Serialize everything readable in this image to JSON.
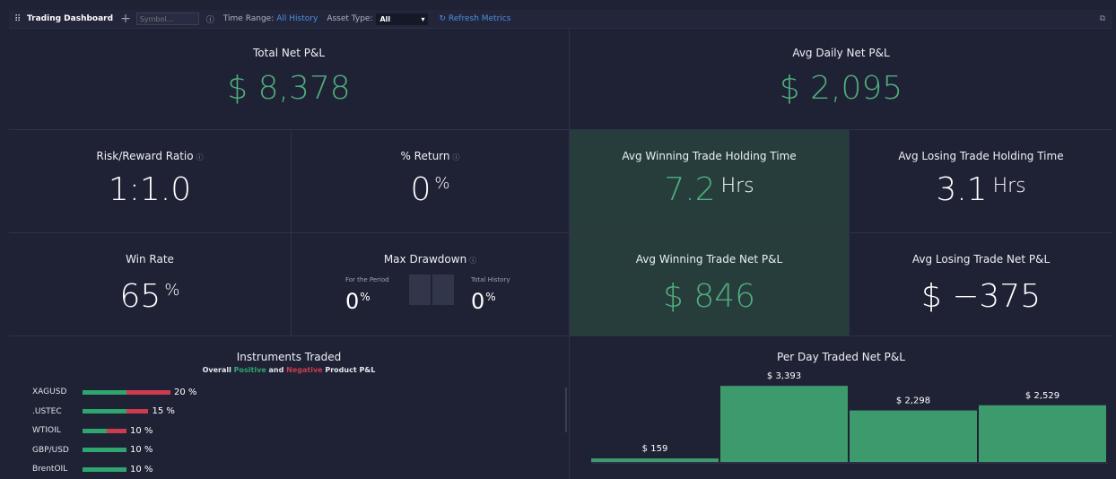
{
  "toolbar": {
    "title": "Trading Dashboard",
    "symbol_placeholder": "Symbol...",
    "time_range_label": "Time Range:",
    "time_range_value": "All History",
    "asset_type_label": "Asset Type:",
    "asset_type_value": "All",
    "refresh_label": "Refresh Metrics"
  },
  "total_pnl": {
    "label": "Total Net P&L",
    "value": "$ 8,378"
  },
  "avg_daily_pnl": {
    "label": "Avg Daily Net P&L",
    "value": "$ 2,095"
  },
  "risk_reward": {
    "label": "Risk/Reward Ratio",
    "value": "1:1.0"
  },
  "pct_return": {
    "label": "% Return",
    "value": "0",
    "unit": "%"
  },
  "avg_win_time": {
    "label": "Avg Winning Trade Holding Time",
    "value": "7.2",
    "unit": "Hrs"
  },
  "avg_loss_time": {
    "label": "Avg Losing Trade Holding Time",
    "value": "3.1",
    "unit": "Hrs"
  },
  "win_rate": {
    "label": "Win Rate",
    "value": "65",
    "unit": "%"
  },
  "max_drawdown": {
    "label": "Max Drawdown",
    "period_label": "For the Period",
    "period_value": "0",
    "history_label": "Total History",
    "history_value": "0",
    "unit": "%"
  },
  "avg_win_pnl": {
    "label": "Avg Winning Trade Net P&L",
    "value": "$ 846"
  },
  "avg_loss_pnl": {
    "label": "Avg Losing Trade Net P&L",
    "value": "$ −375"
  },
  "instruments": {
    "title": "Instruments Traded",
    "subtitle_pre": "Overall ",
    "subtitle_pos": "Positive",
    "subtitle_mid": " and ",
    "subtitle_neg": "Negative",
    "subtitle_post": " Product P&L",
    "items": [
      {
        "name": "XAGUSD",
        "pct": "20 %",
        "pos_share": 0.5,
        "neg_share": 0.5,
        "share": 20
      },
      {
        "name": ".USTEC",
        "pct": "15 %",
        "pos_share": 0.67,
        "neg_share": 0.33,
        "share": 15
      },
      {
        "name": "WTIOIL",
        "pct": "10 %",
        "pos_share": 0.55,
        "neg_share": 0.45,
        "share": 10
      },
      {
        "name": "GBP/USD",
        "pct": "10 %",
        "pos_share": 1.0,
        "neg_share": 0.0,
        "share": 10
      },
      {
        "name": "BrentOIL",
        "pct": "10 %",
        "pos_share": 1.0,
        "neg_share": 0.0,
        "share": 10
      }
    ]
  },
  "colors": {
    "positive": "#2fa56f",
    "negative": "#cc3b4e",
    "accent": "#4d8fe0",
    "bar": "#3d9a6d"
  },
  "chart_data": {
    "type": "bar",
    "title": "Per Day Traded Net P&L",
    "values": [
      159,
      3393,
      2298,
      2529
    ],
    "value_labels": [
      "$ 159",
      "$ 3,393",
      "$ 2,298",
      "$ 2,529"
    ],
    "ylim": [
      0,
      3400
    ]
  }
}
